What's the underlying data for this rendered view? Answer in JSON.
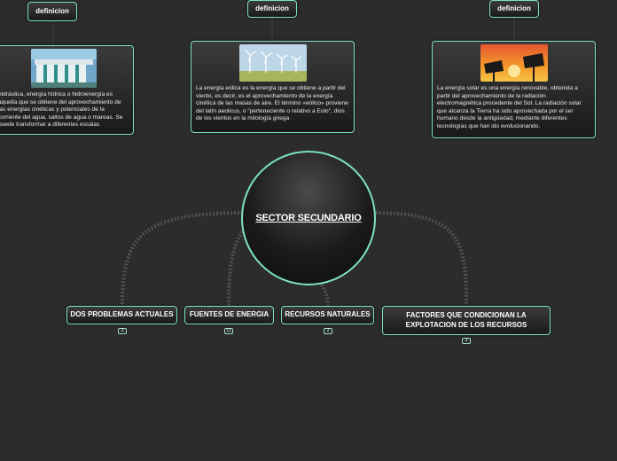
{
  "central_topic": "SECTOR SECUNDARIO",
  "definition_labels": [
    "definicion",
    "definicion",
    "definicion"
  ],
  "cards": [
    {
      "image_icon": "dam-icon",
      "text": "hidráulica, energía hídrica o hidroenergía es aquella que se obtiene del aprovechamiento de las energías cinéticas y potenciales de la corriente del agua, saltos de agua o mareas. Se puede transformar a diferentes escalas"
    },
    {
      "image_icon": "wind-turbines-icon",
      "text": "La energía eólica es la energía que se obtiene a partir del viento, es decir, es el aprovechamiento de la energía cinética de las masas de aire. El término «eólico» proviene del latín aeolicus, o \"perteneciente o relativo a Eolo\", dios de los vientos en la mitología griega"
    },
    {
      "image_icon": "solar-panels-icon",
      "text": "La energía solar es una energía renovable, obtenida a partir del aprovechamiento de la radiación electromagnética procedente del Sol. La radiación solar que alcanza la Tierra ha sido aprovechada por el ser humano desde la antigüedad, mediante diferentes tecnologías que han ido evolucionando."
    }
  ],
  "subtopics": [
    {
      "label": "DOS PROBLEMAS ACTUALES",
      "count": "3"
    },
    {
      "label": "FUENTES DE ENERGIA",
      "count": "11"
    },
    {
      "label": "RECURSOS NATURALES",
      "count": "2"
    },
    {
      "label": "FACTORES QUE CONDICIONAN LA EXPLOTACION DE LOS RECURSOS",
      "count": "3"
    }
  ],
  "colors": {
    "border": "#7de1c6",
    "background": "#2c2c2c",
    "connector": "#555555"
  }
}
